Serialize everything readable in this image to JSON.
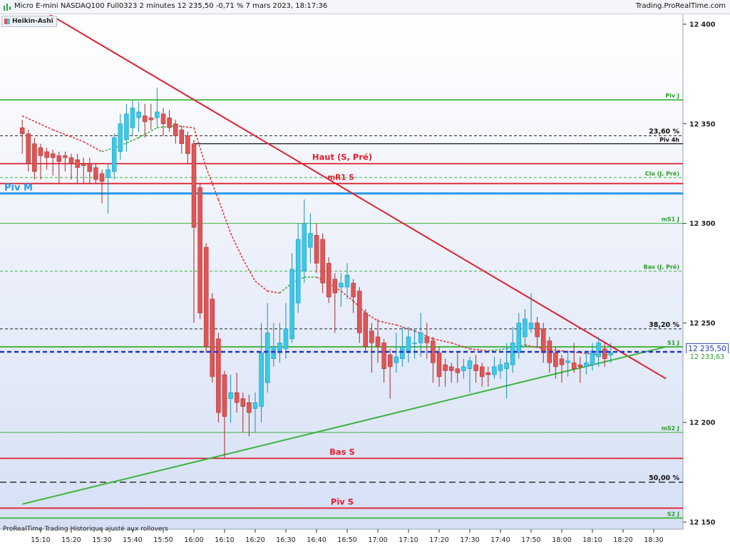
{
  "window": {
    "title": "Micro E-mini NASDAQ100 Full0323 2 minutes 12 235,50 -0,71 % 7 mars 2023, 18:17:36",
    "brand": "Trading.ProRealTime.com"
  },
  "legend": {
    "label": "Heikin-Ashi"
  },
  "footer": {
    "note": "ProRealTime Trading  Historique ajusté aux rollovers"
  },
  "badges": {
    "last_price": "12 235,50",
    "avg_price": "12 233,63"
  },
  "colors": {
    "bull": "#3cc8e8",
    "bear": "#e05555",
    "support": "#3cb43c",
    "resistance": "#e02030",
    "pivot_month": "#2a9ae8",
    "last_line": "#2233cc"
  },
  "chart_data": {
    "type": "candlestick",
    "chart_type": "heikin-ashi",
    "ylim": [
      12145,
      12410
    ],
    "y_ticks": [
      {
        "value": 12400,
        "label": "12 400"
      },
      {
        "value": 12350,
        "label": "12 350"
      },
      {
        "value": 12300,
        "label": "12 300"
      },
      {
        "value": 12250,
        "label": "12 250"
      },
      {
        "value": 12200,
        "label": "12 200"
      },
      {
        "value": 12150,
        "label": "12 150"
      }
    ],
    "x_ticks": [
      "15:10",
      "15:20",
      "15:30",
      "15:40",
      "15:50",
      "16:00",
      "16:10",
      "16:20",
      "16:30",
      "16:40",
      "16:50",
      "17:00",
      "17:10",
      "17:20",
      "17:30",
      "17:40",
      "17:50",
      "18:00",
      "18:10",
      "18:20",
      "18:30"
    ],
    "levels": [
      {
        "name": "Piv J",
        "value": 12362,
        "color": "#3cb43c",
        "style": "solid",
        "label_pos": "right"
      },
      {
        "name": "23,60 %",
        "value": 12344,
        "color": "#222222",
        "style": "dashed",
        "label_pos": "right"
      },
      {
        "name": "Piv 4h",
        "value": 12340,
        "color": "#111111",
        "style": "solid",
        "label_pos": "right",
        "x_start": "16:00"
      },
      {
        "name": "Haut (S, Pré)",
        "value": 12330,
        "color": "#e02030",
        "style": "solid",
        "label_pos": "center"
      },
      {
        "name": "Clo (J, Pré)",
        "value": 12323,
        "color": "#3cb43c",
        "style": "dashed",
        "label_pos": "right"
      },
      {
        "name": "mR1 S",
        "value": 12320,
        "color": "#e02030",
        "style": "solid",
        "label_pos": "center-small"
      },
      {
        "name": "Piv M",
        "value": 12315,
        "color": "#2a9ae8",
        "style": "thick",
        "label_pos": "left"
      },
      {
        "name": "mS1 J",
        "value": 12300,
        "color": "#3cb43c",
        "style": "thin",
        "label_pos": "right"
      },
      {
        "name": "Bas (J, Pré)",
        "value": 12276,
        "color": "#3cb43c",
        "style": "dashed",
        "label_pos": "right"
      },
      {
        "name": "38,20 %",
        "value": 12247,
        "color": "#222222",
        "style": "dashed",
        "label_pos": "right"
      },
      {
        "name": "S1 J",
        "value": 12238,
        "color": "#3cb43c",
        "style": "solid",
        "label_pos": "right"
      },
      {
        "name": "mS2 J",
        "value": 12195,
        "color": "#3cb43c",
        "style": "thin",
        "label_pos": "right"
      },
      {
        "name": "Bas S",
        "value": 12182,
        "color": "#e02030",
        "style": "solid",
        "label_pos": "center"
      },
      {
        "name": "50,00 %",
        "value": 12170,
        "color": "#222222",
        "style": "dashed-long",
        "label_pos": "right"
      },
      {
        "name": "Piv S",
        "value": 12157,
        "color": "#e02030",
        "style": "solid",
        "label_pos": "center"
      },
      {
        "name": "S2 J",
        "value": 12152,
        "color": "#3cb43c",
        "style": "solid",
        "label_pos": "right"
      }
    ],
    "last_price_line": 12235.5,
    "trendlines": [
      {
        "color": "#e02030",
        "from": [
          "15:04",
          12413
        ],
        "to": [
          "18:34",
          12222
        ]
      },
      {
        "color": "#3cb43c",
        "from": [
          "15:04",
          12159
        ],
        "to": [
          "18:34",
          12238
        ]
      }
    ],
    "moving_average": [
      [
        "15:04",
        12354
      ],
      [
        "15:14",
        12347
      ],
      [
        "15:24",
        12341
      ],
      [
        "15:30",
        12336
      ],
      [
        "15:36",
        12339
      ],
      [
        "15:42",
        12343
      ],
      [
        "15:48",
        12348
      ],
      [
        "15:54",
        12349
      ],
      [
        "16:00",
        12348
      ],
      [
        "16:04",
        12328
      ],
      [
        "16:08",
        12312
      ],
      [
        "16:12",
        12295
      ],
      [
        "16:16",
        12282
      ],
      [
        "16:20",
        12271
      ],
      [
        "16:24",
        12266
      ],
      [
        "16:28",
        12265
      ],
      [
        "16:32",
        12270
      ],
      [
        "16:36",
        12273
      ],
      [
        "16:40",
        12273
      ],
      [
        "16:44",
        12270
      ],
      [
        "16:48",
        12266
      ],
      [
        "16:52",
        12261
      ],
      [
        "16:56",
        12255
      ],
      [
        "17:00",
        12251
      ],
      [
        "17:06",
        12249
      ],
      [
        "17:12",
        12246
      ],
      [
        "17:18",
        12242
      ],
      [
        "17:24",
        12240
      ],
      [
        "17:30",
        12237
      ],
      [
        "17:36",
        12236
      ],
      [
        "17:42",
        12237
      ],
      [
        "17:48",
        12239
      ],
      [
        "17:54",
        12237
      ],
      [
        "18:00",
        12236
      ],
      [
        "18:06",
        12235
      ],
      [
        "18:12",
        12234
      ],
      [
        "18:16",
        12234
      ]
    ],
    "candles": [
      {
        "t": "15:04",
        "o": 12348,
        "h": 12352,
        "l": 12335,
        "c": 12345
      },
      {
        "t": "15:06",
        "o": 12345,
        "h": 12347,
        "l": 12326,
        "c": 12330
      },
      {
        "t": "15:08",
        "o": 12340,
        "h": 12343,
        "l": 12322,
        "c": 12326
      },
      {
        "t": "15:10",
        "o": 12338,
        "h": 12340,
        "l": 12322,
        "c": 12334
      },
      {
        "t": "15:12",
        "o": 12336,
        "h": 12338,
        "l": 12327,
        "c": 12333
      },
      {
        "t": "15:14",
        "o": 12335,
        "h": 12337,
        "l": 12324,
        "c": 12333
      },
      {
        "t": "15:16",
        "o": 12334,
        "h": 12336,
        "l": 12320,
        "c": 12331
      },
      {
        "t": "15:18",
        "o": 12334,
        "h": 12336,
        "l": 12326,
        "c": 12333
      },
      {
        "t": "15:20",
        "o": 12333,
        "h": 12335,
        "l": 12322,
        "c": 12330
      },
      {
        "t": "15:22",
        "o": 12332,
        "h": 12335,
        "l": 12320,
        "c": 12328
      },
      {
        "t": "15:24",
        "o": 12330,
        "h": 12333,
        "l": 12320,
        "c": 12329
      },
      {
        "t": "15:26",
        "o": 12330,
        "h": 12333,
        "l": 12320,
        "c": 12326
      },
      {
        "t": "15:28",
        "o": 12328,
        "h": 12330,
        "l": 12320,
        "c": 12322
      },
      {
        "t": "15:30",
        "o": 12325,
        "h": 12327,
        "l": 12310,
        "c": 12321
      },
      {
        "t": "15:32",
        "o": 12323,
        "h": 12330,
        "l": 12305,
        "c": 12327
      },
      {
        "t": "15:34",
        "o": 12326,
        "h": 12345,
        "l": 12322,
        "c": 12343
      },
      {
        "t": "15:36",
        "o": 12336,
        "h": 12355,
        "l": 12332,
        "c": 12350
      },
      {
        "t": "15:38",
        "o": 12342,
        "h": 12360,
        "l": 12336,
        "c": 12355
      },
      {
        "t": "15:40",
        "o": 12348,
        "h": 12362,
        "l": 12344,
        "c": 12358
      },
      {
        "t": "15:42",
        "o": 12353,
        "h": 12361,
        "l": 12346,
        "c": 12356
      },
      {
        "t": "15:44",
        "o": 12354,
        "h": 12360,
        "l": 12343,
        "c": 12351
      },
      {
        "t": "15:46",
        "o": 12353,
        "h": 12360,
        "l": 12347,
        "c": 12352
      },
      {
        "t": "15:48",
        "o": 12353,
        "h": 12368,
        "l": 12348,
        "c": 12356
      },
      {
        "t": "15:50",
        "o": 12355,
        "h": 12358,
        "l": 12344,
        "c": 12350
      },
      {
        "t": "15:52",
        "o": 12353,
        "h": 12357,
        "l": 12346,
        "c": 12348
      },
      {
        "t": "15:54",
        "o": 12350,
        "h": 12352,
        "l": 12340,
        "c": 12344
      },
      {
        "t": "15:56",
        "o": 12347,
        "h": 12349,
        "l": 12335,
        "c": 12340
      },
      {
        "t": "15:58",
        "o": 12344,
        "h": 12346,
        "l": 12330,
        "c": 12335
      },
      {
        "t": "16:00",
        "o": 12340,
        "h": 12342,
        "l": 12250,
        "c": 12298
      },
      {
        "t": "16:02",
        "o": 12318,
        "h": 12320,
        "l": 12252,
        "c": 12255
      },
      {
        "t": "16:04",
        "o": 12288,
        "h": 12290,
        "l": 12235,
        "c": 12238
      },
      {
        "t": "16:06",
        "o": 12262,
        "h": 12265,
        "l": 12220,
        "c": 12223
      },
      {
        "t": "16:08",
        "o": 12242,
        "h": 12245,
        "l": 12200,
        "c": 12205
      },
      {
        "t": "16:10",
        "o": 12224,
        "h": 12226,
        "l": 12182,
        "c": 12203
      },
      {
        "t": "16:12",
        "o": 12212,
        "h": 12224,
        "l": 12200,
        "c": 12215
      },
      {
        "t": "16:14",
        "o": 12215,
        "h": 12225,
        "l": 12205,
        "c": 12210
      },
      {
        "t": "16:16",
        "o": 12212,
        "h": 12215,
        "l": 12195,
        "c": 12208
      },
      {
        "t": "16:18",
        "o": 12210,
        "h": 12214,
        "l": 12193,
        "c": 12205
      },
      {
        "t": "16:20",
        "o": 12207,
        "h": 12215,
        "l": 12195,
        "c": 12210
      },
      {
        "t": "16:22",
        "o": 12208,
        "h": 12250,
        "l": 12200,
        "c": 12235
      },
      {
        "t": "16:24",
        "o": 12220,
        "h": 12260,
        "l": 12215,
        "c": 12245
      },
      {
        "t": "16:26",
        "o": 12232,
        "h": 12250,
        "l": 12228,
        "c": 12238
      },
      {
        "t": "16:28",
        "o": 12235,
        "h": 12250,
        "l": 12230,
        "c": 12240
      },
      {
        "t": "16:30",
        "o": 12237,
        "h": 12260,
        "l": 12232,
        "c": 12247
      },
      {
        "t": "16:32",
        "o": 12242,
        "h": 12285,
        "l": 12240,
        "c": 12277
      },
      {
        "t": "16:34",
        "o": 12260,
        "h": 12300,
        "l": 12255,
        "c": 12292
      },
      {
        "t": "16:36",
        "o": 12276,
        "h": 12312,
        "l": 12270,
        "c": 12300
      },
      {
        "t": "16:38",
        "o": 12288,
        "h": 12305,
        "l": 12280,
        "c": 12295
      },
      {
        "t": "16:40",
        "o": 12294,
        "h": 12300,
        "l": 12275,
        "c": 12280
      },
      {
        "t": "16:42",
        "o": 12292,
        "h": 12295,
        "l": 12265,
        "c": 12270
      },
      {
        "t": "16:44",
        "o": 12280,
        "h": 12283,
        "l": 12260,
        "c": 12263
      },
      {
        "t": "16:46",
        "o": 12272,
        "h": 12275,
        "l": 12245,
        "c": 12265
      },
      {
        "t": "16:48",
        "o": 12268,
        "h": 12275,
        "l": 12258,
        "c": 12270
      },
      {
        "t": "16:50",
        "o": 12268,
        "h": 12280,
        "l": 12262,
        "c": 12274
      },
      {
        "t": "16:52",
        "o": 12270,
        "h": 12272,
        "l": 12255,
        "c": 12263
      },
      {
        "t": "16:54",
        "o": 12266,
        "h": 12268,
        "l": 12240,
        "c": 12245
      },
      {
        "t": "16:56",
        "o": 12255,
        "h": 12257,
        "l": 12235,
        "c": 12238
      },
      {
        "t": "16:58",
        "o": 12246,
        "h": 12250,
        "l": 12225,
        "c": 12240
      },
      {
        "t": "17:00",
        "o": 12243,
        "h": 12252,
        "l": 12230,
        "c": 12238
      },
      {
        "t": "17:02",
        "o": 12240,
        "h": 12242,
        "l": 12220,
        "c": 12227
      },
      {
        "t": "17:04",
        "o": 12234,
        "h": 12237,
        "l": 12212,
        "c": 12228
      },
      {
        "t": "17:06",
        "o": 12230,
        "h": 12245,
        "l": 12225,
        "c": 12233
      },
      {
        "t": "17:08",
        "o": 12232,
        "h": 12248,
        "l": 12228,
        "c": 12238
      },
      {
        "t": "17:10",
        "o": 12235,
        "h": 12248,
        "l": 12230,
        "c": 12243
      },
      {
        "t": "17:12",
        "o": 12240,
        "h": 12247,
        "l": 12232,
        "c": 12240
      },
      {
        "t": "17:14",
        "o": 12240,
        "h": 12255,
        "l": 12233,
        "c": 12245
      },
      {
        "t": "17:16",
        "o": 12243,
        "h": 12250,
        "l": 12232,
        "c": 12240
      },
      {
        "t": "17:18",
        "o": 12241,
        "h": 12243,
        "l": 12220,
        "c": 12230
      },
      {
        "t": "17:20",
        "o": 12235,
        "h": 12238,
        "l": 12218,
        "c": 12223
      },
      {
        "t": "17:22",
        "o": 12229,
        "h": 12232,
        "l": 12218,
        "c": 12226
      },
      {
        "t": "17:24",
        "o": 12228,
        "h": 12230,
        "l": 12220,
        "c": 12226
      },
      {
        "t": "17:26",
        "o": 12227,
        "h": 12235,
        "l": 12220,
        "c": 12225
      },
      {
        "t": "17:28",
        "o": 12226,
        "h": 12232,
        "l": 12222,
        "c": 12228
      },
      {
        "t": "17:30",
        "o": 12227,
        "h": 12233,
        "l": 12215,
        "c": 12231
      },
      {
        "t": "17:32",
        "o": 12229,
        "h": 12234,
        "l": 12220,
        "c": 12226
      },
      {
        "t": "17:34",
        "o": 12228,
        "h": 12230,
        "l": 12218,
        "c": 12223
      },
      {
        "t": "17:36",
        "o": 12225,
        "h": 12228,
        "l": 12218,
        "c": 12224
      },
      {
        "t": "17:38",
        "o": 12224,
        "h": 12233,
        "l": 12222,
        "c": 12228
      },
      {
        "t": "17:40",
        "o": 12226,
        "h": 12232,
        "l": 12222,
        "c": 12229
      },
      {
        "t": "17:42",
        "o": 12227,
        "h": 12240,
        "l": 12212,
        "c": 12230
      },
      {
        "t": "17:44",
        "o": 12229,
        "h": 12248,
        "l": 12225,
        "c": 12240
      },
      {
        "t": "17:46",
        "o": 12235,
        "h": 12255,
        "l": 12232,
        "c": 12250
      },
      {
        "t": "17:48",
        "o": 12243,
        "h": 12257,
        "l": 12238,
        "c": 12252
      },
      {
        "t": "17:50",
        "o": 12247,
        "h": 12265,
        "l": 12245,
        "c": 12250
      },
      {
        "t": "17:52",
        "o": 12250,
        "h": 12253,
        "l": 12238,
        "c": 12243
      },
      {
        "t": "17:54",
        "o": 12247,
        "h": 12250,
        "l": 12230,
        "c": 12235
      },
      {
        "t": "17:56",
        "o": 12241,
        "h": 12243,
        "l": 12225,
        "c": 12230
      },
      {
        "t": "17:58",
        "o": 12235,
        "h": 12238,
        "l": 12222,
        "c": 12228
      },
      {
        "t": "18:00",
        "o": 12232,
        "h": 12234,
        "l": 12220,
        "c": 12229
      },
      {
        "t": "18:02",
        "o": 12230,
        "h": 12236,
        "l": 12223,
        "c": 12231
      },
      {
        "t": "18:04",
        "o": 12230,
        "h": 12240,
        "l": 12225,
        "c": 12227
      },
      {
        "t": "18:06",
        "o": 12229,
        "h": 12233,
        "l": 12220,
        "c": 12228
      },
      {
        "t": "18:08",
        "o": 12228,
        "h": 12236,
        "l": 12224,
        "c": 12230
      },
      {
        "t": "18:10",
        "o": 12229,
        "h": 12240,
        "l": 12226,
        "c": 12236
      },
      {
        "t": "18:12",
        "o": 12233,
        "h": 12243,
        "l": 12228,
        "c": 12240
      },
      {
        "t": "18:14",
        "o": 12237,
        "h": 12240,
        "l": 12228,
        "c": 12232
      },
      {
        "t": "18:16",
        "o": 12234,
        "h": 12240,
        "l": 12230,
        "c": 12235
      }
    ]
  }
}
